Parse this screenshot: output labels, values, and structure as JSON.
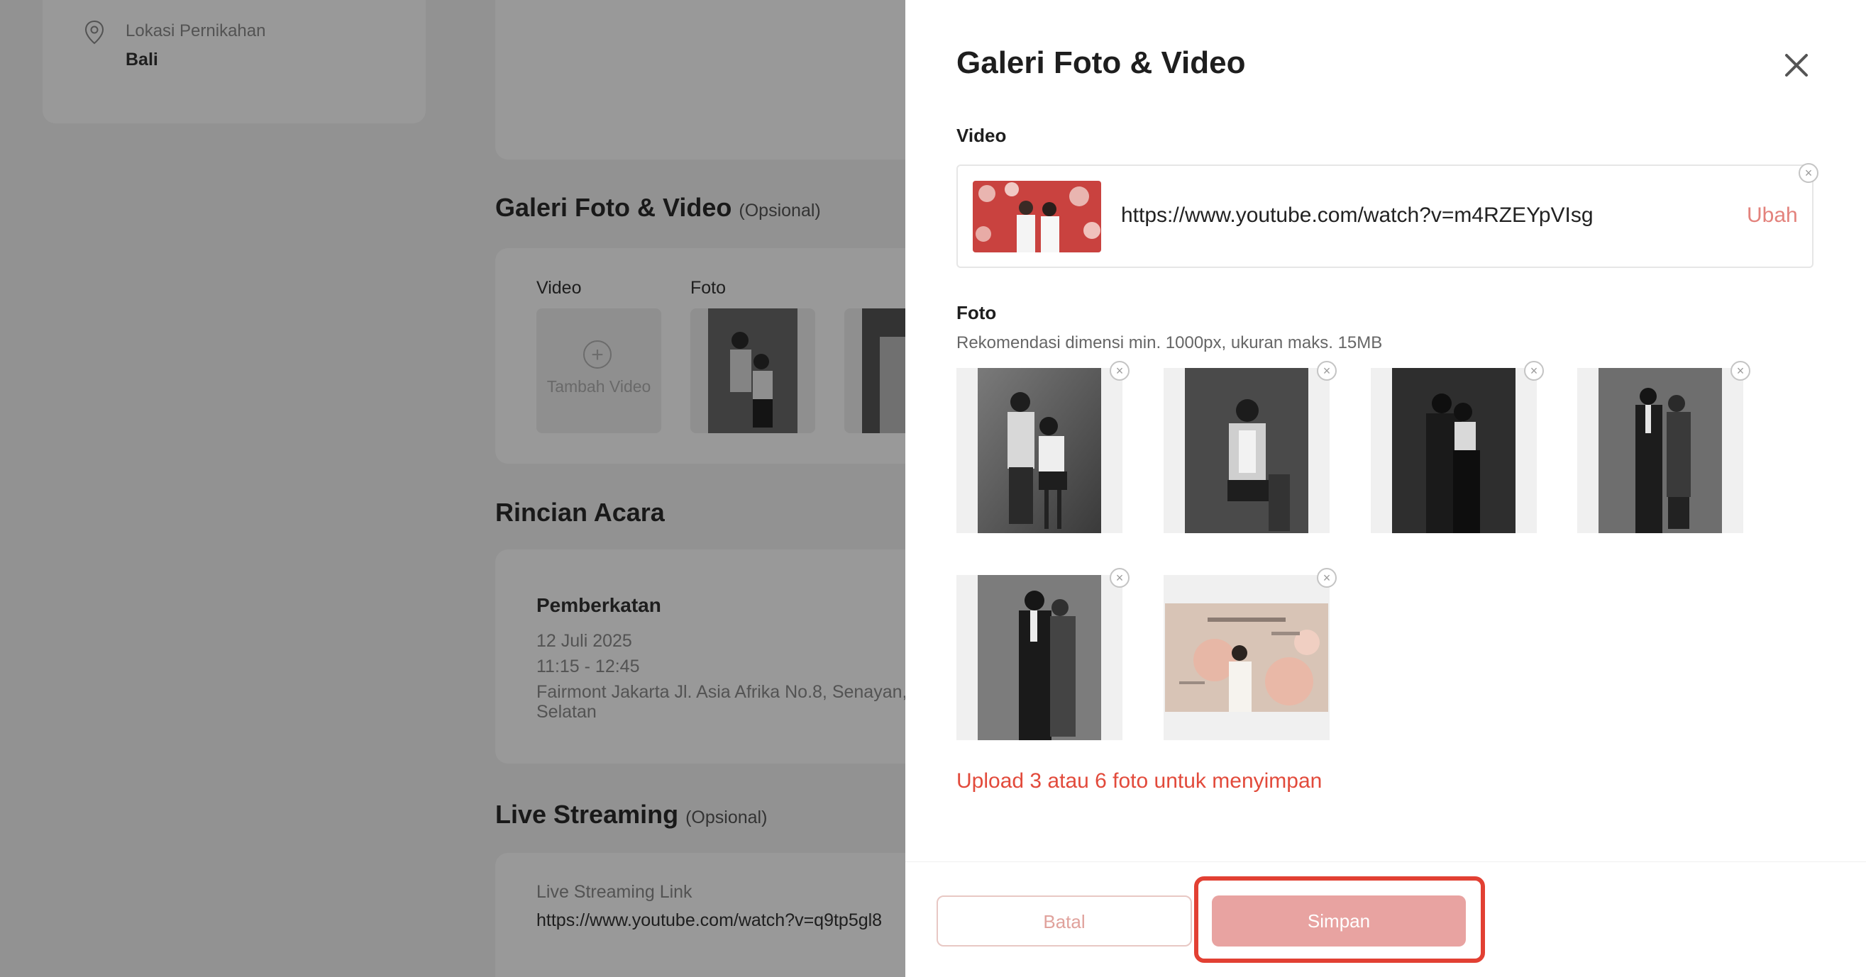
{
  "background": {
    "location": {
      "label": "Lokasi Pernikahan",
      "value": "Bali"
    },
    "gallery": {
      "title": "Galeri Foto & Video",
      "optional": "(Opsional)",
      "video_label": "Video",
      "photo_label": "Foto",
      "add_video": "Tambah Video"
    },
    "rincian": {
      "title": "Rincian Acara",
      "event_name": "Pemberkatan",
      "date": "12 Juli 2025",
      "time": "11:15 - 12:45",
      "address_line1": "Fairmont Jakarta Jl. Asia Afrika No.8, Senayan,",
      "address_line2": "Selatan"
    },
    "live": {
      "title": "Live Streaming",
      "optional": "(Opsional)",
      "link_label": "Live Streaming Link",
      "link_value": "https://www.youtube.com/watch?v=q9tp5gl8"
    }
  },
  "modal": {
    "title": "Galeri Foto & Video",
    "close_icon": "close-icon",
    "video_section_label": "Video",
    "video_url": "https://www.youtube.com/watch?v=m4RZEYpVIsg",
    "change_label": "Ubah",
    "foto_section_label": "Foto",
    "foto_hint": "Rekomendasi dimensi min. 1000px, ukuran maks. 15MB",
    "photo_count": 6,
    "error_message": "Upload 3 atau 6 foto untuk menyimpan",
    "cancel_label": "Batal",
    "save_label": "Simpan"
  },
  "colors": {
    "accent": "#e3827c",
    "save_button": "#e8a3a1",
    "error": "#e24a3b",
    "highlight": "#e24033"
  }
}
